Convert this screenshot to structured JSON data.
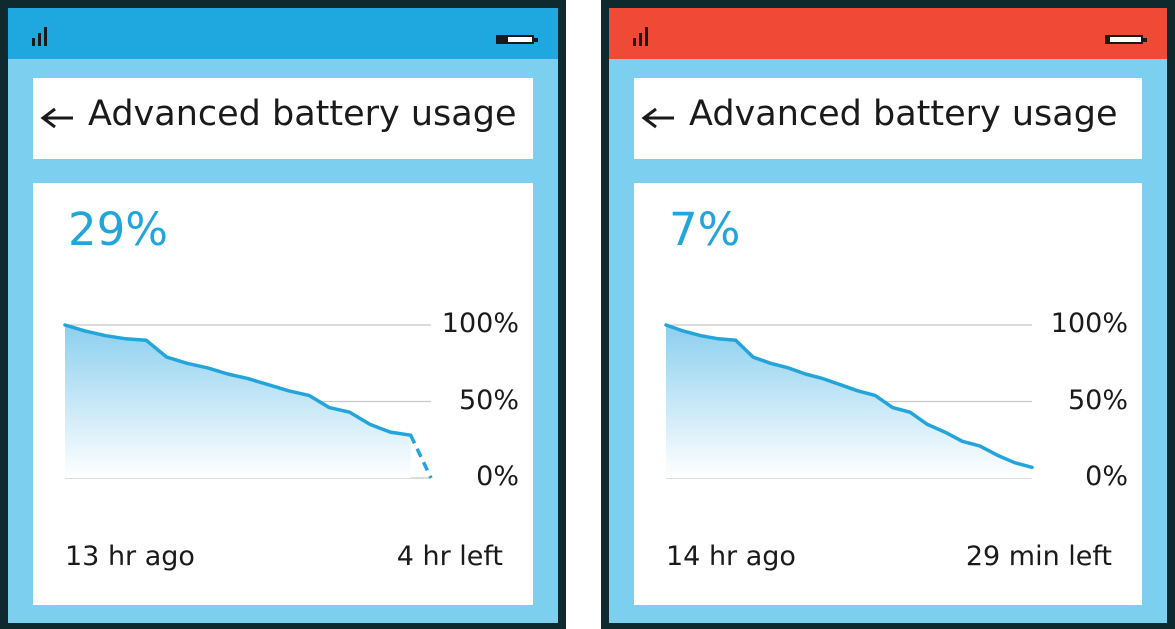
{
  "screens": [
    {
      "status_color": "#1ea8df",
      "battery_fill": 0.29,
      "header": {
        "title": "Advanced battery usage"
      },
      "percent": "29%",
      "axis": {
        "top": "100%",
        "mid": "50%",
        "bottom": "0%"
      },
      "time_start": "13 hr ago",
      "time_left": "4 hr left"
    },
    {
      "status_color": "#f04a36",
      "battery_fill": 0.07,
      "header": {
        "title": "Advanced battery usage"
      },
      "percent": "7%",
      "axis": {
        "top": "100%",
        "mid": "50%",
        "bottom": "0%"
      },
      "time_start": "14 hr ago",
      "time_left": "29 min left"
    }
  ],
  "chart_data": [
    {
      "type": "area",
      "ylim": [
        0,
        100
      ],
      "x_start": "13 hr ago",
      "x_end": "4 hr left",
      "series": [
        {
          "values": [
            100,
            96,
            93,
            91,
            90,
            79,
            75,
            72,
            68,
            65,
            61,
            57,
            54,
            46,
            43,
            35,
            30,
            28
          ]
        },
        {
          "projected": true,
          "values": [
            28,
            0
          ]
        }
      ]
    },
    {
      "type": "area",
      "ylim": [
        0,
        100
      ],
      "x_start": "14 hr ago",
      "x_end": "29 min left",
      "series": [
        {
          "values": [
            100,
            96,
            93,
            91,
            90,
            79,
            75,
            72,
            68,
            65,
            61,
            57,
            54,
            46,
            43,
            35,
            30,
            24,
            21,
            15,
            10,
            7
          ]
        }
      ]
    }
  ]
}
